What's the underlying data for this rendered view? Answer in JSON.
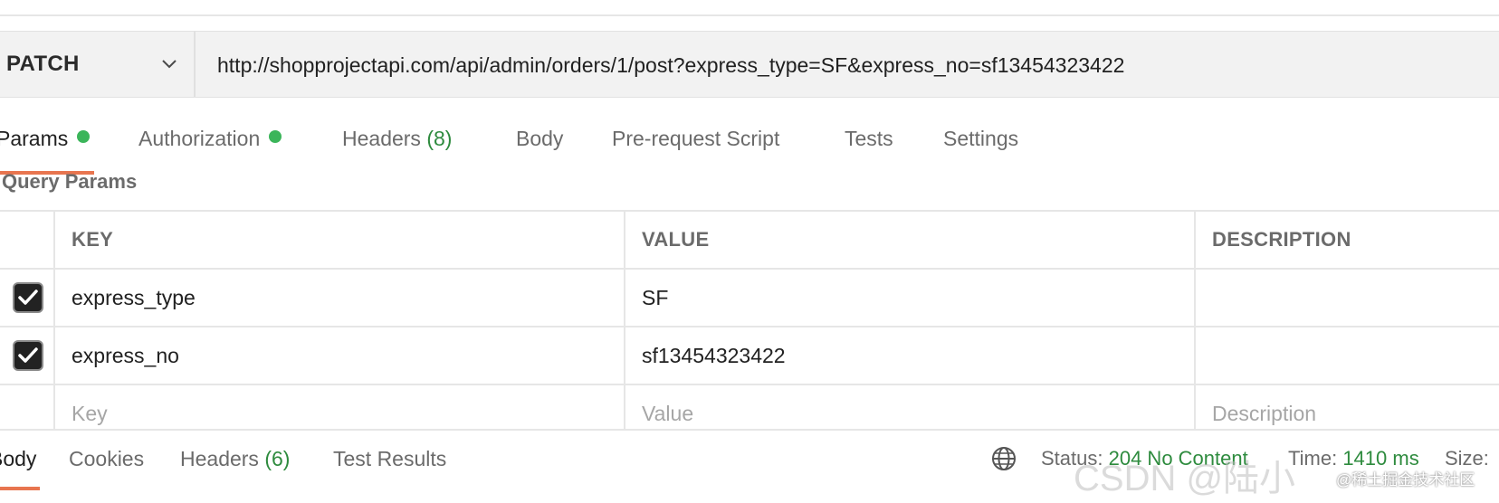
{
  "request": {
    "method": "PATCH",
    "url": "http://shopprojectapi.com/api/admin/orders/1/post?express_type=SF&express_no=sf13454323422"
  },
  "request_tabs": [
    {
      "label": "Params",
      "active": true,
      "dot": true
    },
    {
      "label": "Authorization",
      "dot": true
    },
    {
      "label": "Headers",
      "count": "(8)"
    },
    {
      "label": "Body"
    },
    {
      "label": "Pre-request Script"
    },
    {
      "label": "Tests"
    },
    {
      "label": "Settings"
    }
  ],
  "query_params": {
    "title": "Query Params",
    "columns": [
      "KEY",
      "VALUE",
      "DESCRIPTION"
    ],
    "rows": [
      {
        "checked": true,
        "key": "express_type",
        "value": "SF",
        "description": ""
      },
      {
        "checked": true,
        "key": "express_no",
        "value": "sf13454323422",
        "description": ""
      }
    ],
    "placeholders": {
      "key": "Key",
      "value": "Value",
      "description": "Description"
    }
  },
  "response_tabs": [
    {
      "label": "Body",
      "active": true
    },
    {
      "label": "Cookies"
    },
    {
      "label": "Headers",
      "count": "(6)"
    },
    {
      "label": "Test Results"
    }
  ],
  "response_status": {
    "status_label": "Status:",
    "status_value": "204 No Content",
    "time_label": "Time:",
    "time_value": "1410 ms",
    "size_label": "Size:"
  },
  "watermark": {
    "main": "CSDN @陆小",
    "small": "@稀土掘金技术社区"
  },
  "colors": {
    "accent": "#e8754f",
    "success": "#2e8b3e",
    "dot": "#3bb55a"
  }
}
